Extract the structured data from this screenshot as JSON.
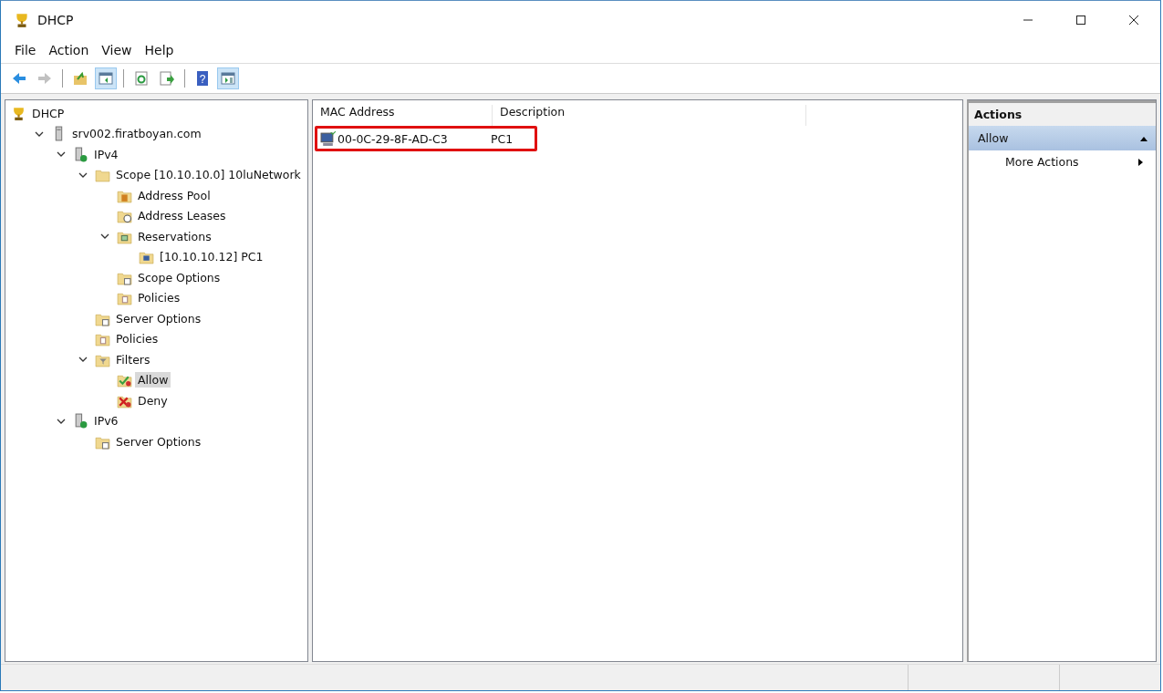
{
  "window": {
    "title": "DHCP"
  },
  "menu": [
    "File",
    "Action",
    "View",
    "Help"
  ],
  "toolbar": [
    {
      "kind": "back",
      "disabled": false
    },
    {
      "kind": "forward",
      "disabled": true
    },
    {
      "kind": "sep"
    },
    {
      "kind": "up",
      "disabled": false
    },
    {
      "kind": "tree",
      "disabled": false,
      "on": true
    },
    {
      "kind": "sep"
    },
    {
      "kind": "refresh",
      "disabled": false
    },
    {
      "kind": "export",
      "disabled": false
    },
    {
      "kind": "sep"
    },
    {
      "kind": "help",
      "disabled": false,
      "glyph": "?"
    },
    {
      "kind": "actionpane",
      "disabled": false,
      "on": true
    }
  ],
  "tree": [
    {
      "label": "DHCP",
      "kind": "dhcp",
      "selected": false,
      "children": [
        {
          "label": "srv002.firatboyan.com",
          "kind": "server",
          "selected": false,
          "expanded": true,
          "children": [
            {
              "label": "IPv4",
              "kind": "ip",
              "selected": false,
              "expanded": true,
              "children": [
                {
                  "label": "Scope [10.10.10.0] 10luNetwork",
                  "kind": "folder",
                  "selected": false,
                  "expanded": true,
                  "children": [
                    {
                      "label": "Address Pool",
                      "kind": "pool",
                      "selected": false
                    },
                    {
                      "label": "Address Leases",
                      "kind": "leases",
                      "selected": false
                    },
                    {
                      "label": "Reservations",
                      "kind": "reservations",
                      "selected": false,
                      "expanded": true,
                      "children": [
                        {
                          "label": "[10.10.10.12] PC1",
                          "kind": "reservation",
                          "selected": false
                        }
                      ]
                    },
                    {
                      "label": "Scope Options",
                      "kind": "options",
                      "selected": false
                    },
                    {
                      "label": "Policies",
                      "kind": "policies",
                      "selected": false
                    }
                  ]
                },
                {
                  "label": "Server Options",
                  "kind": "options",
                  "selected": false
                },
                {
                  "label": "Policies",
                  "kind": "policies",
                  "selected": false
                },
                {
                  "label": "Filters",
                  "kind": "filters",
                  "selected": false,
                  "expanded": true,
                  "children": [
                    {
                      "label": "Allow",
                      "kind": "allow",
                      "selected": true
                    },
                    {
                      "label": "Deny",
                      "kind": "deny",
                      "selected": false
                    }
                  ]
                }
              ]
            },
            {
              "label": "IPv6",
              "kind": "ip",
              "selected": false,
              "expanded": true,
              "children": [
                {
                  "label": "Server Options",
                  "kind": "options",
                  "selected": false
                }
              ]
            }
          ]
        }
      ]
    }
  ],
  "list": {
    "columns": [
      "MAC Address",
      "Description"
    ],
    "rows": [
      {
        "mac": "00-0C-29-8F-AD-C3",
        "description": "PC1",
        "highlighted": true
      }
    ]
  },
  "actions": {
    "title": "Actions",
    "section": {
      "label": "Allow",
      "expanded": true
    },
    "items": [
      {
        "label": "More Actions"
      }
    ]
  }
}
